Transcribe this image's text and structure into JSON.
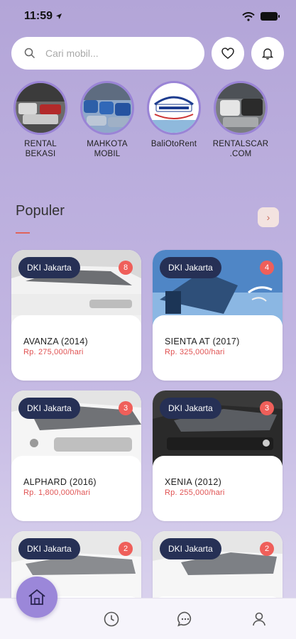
{
  "status_bar": {
    "time": "11:59"
  },
  "search": {
    "placeholder": "Cari mobil..."
  },
  "stores": [
    {
      "name": "RENTAL BEKASI"
    },
    {
      "name": "MAHKOTA MOBIL"
    },
    {
      "name": "BaliOtoRent"
    },
    {
      "name": "RENTALSCAR .COM"
    }
  ],
  "section": {
    "title": "Populer",
    "more_icon": "›"
  },
  "cars": [
    {
      "location": "DKI Jakarta",
      "count": "8",
      "name": "AVANZA (2014)",
      "price": "Rp. 275,000/hari"
    },
    {
      "location": "DKI Jakarta",
      "count": "4",
      "name": "SIENTA AT (2017)",
      "price": "Rp. 325,000/hari"
    },
    {
      "location": "DKI Jakarta",
      "count": "3",
      "name": "ALPHARD (2016)",
      "price": "Rp. 1,800,000/hari"
    },
    {
      "location": "DKI Jakarta",
      "count": "3",
      "name": "XENIA (2012)",
      "price": "Rp. 255,000/hari"
    },
    {
      "location": "DKI Jakarta",
      "count": "2",
      "name": "",
      "price": ""
    },
    {
      "location": "DKI Jakarta",
      "count": "2",
      "name": "",
      "price": ""
    }
  ],
  "colors": {
    "accent": "#9b87d9",
    "badge_dark": "#263055",
    "badge_red": "#ef5f5a",
    "price_red": "#e05252"
  },
  "tabs": [
    {
      "icon": "home-icon",
      "active": true
    },
    {
      "icon": "history-icon",
      "active": false
    },
    {
      "icon": "chat-icon",
      "active": false
    },
    {
      "icon": "profile-icon",
      "active": false
    }
  ]
}
